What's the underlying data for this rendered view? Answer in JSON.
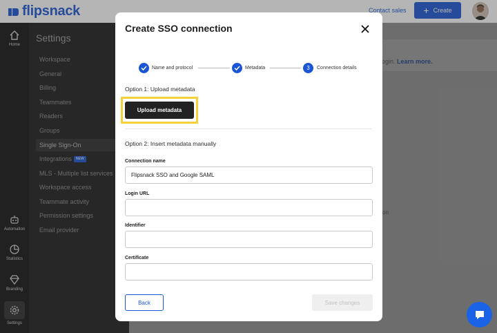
{
  "header": {
    "logo_text": "flipsnack",
    "contact_sales": "Contact sales",
    "create_label": "Create"
  },
  "rail": {
    "items": [
      {
        "label": "Home",
        "icon": "home-icon"
      },
      {
        "label": "Automation",
        "icon": "robot-icon"
      },
      {
        "label": "Statistics",
        "icon": "pie-chart-icon"
      },
      {
        "label": "Branding",
        "icon": "diamond-icon"
      },
      {
        "label": "Settings",
        "icon": "gear-icon"
      }
    ]
  },
  "settings_menu": {
    "title": "Settings",
    "items": [
      {
        "label": "Workspace"
      },
      {
        "label": "General"
      },
      {
        "label": "Billing"
      },
      {
        "label": "Teammates"
      },
      {
        "label": "Readers"
      },
      {
        "label": "Groups"
      },
      {
        "label": "Single Sign-On"
      },
      {
        "label": "Integrations",
        "badge": "NEW"
      },
      {
        "label": "MLS - Multiple list services"
      },
      {
        "label": "Workspace access"
      },
      {
        "label": "Teammate activity"
      },
      {
        "label": "Permission settings"
      },
      {
        "label": "Email provider"
      }
    ]
  },
  "background_main": {
    "text_prefix": "login.",
    "learn_more": "Learn more.",
    "text2": "on"
  },
  "modal": {
    "title": "Create SSO connection",
    "steps": [
      {
        "label": "Name and protocol",
        "state": "done"
      },
      {
        "label": "Metadata",
        "state": "done"
      },
      {
        "label": "Connection details",
        "state": "current",
        "number": "3"
      }
    ],
    "option1_title": "Option 1: Upload metadata",
    "upload_button": "Upload metadata",
    "option2_title": "Option 2: Insert metadata manually",
    "fields": [
      {
        "label": "Connection name",
        "value": "Flipsnack SSO and Google SAML"
      },
      {
        "label": "Login URL",
        "value": ""
      },
      {
        "label": "Identifier",
        "value": ""
      },
      {
        "label": "Certificate",
        "value": ""
      }
    ],
    "back_button": "Back",
    "save_button": "Save changes"
  },
  "colors": {
    "accent": "#1a55d6",
    "highlight": "#f2d13b"
  }
}
